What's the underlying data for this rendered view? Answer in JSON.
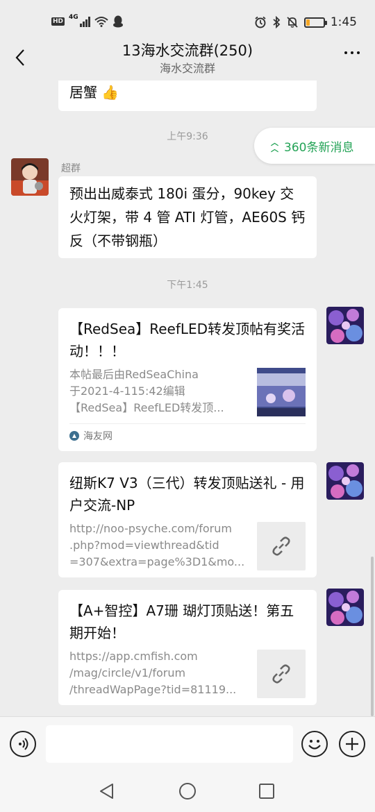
{
  "status_bar": {
    "network_badge": "HD",
    "network_type": "4G",
    "time": "1:45",
    "battery_level": 0.2
  },
  "header": {
    "title": "13海水交流群(250)",
    "subtitle": "海水交流群"
  },
  "new_messages": {
    "label": "360条新消息"
  },
  "messages": {
    "partial_bubble": {
      "text": "居蟹 👍"
    },
    "time_1": "上午9:36",
    "msg_1": {
      "sender": "超群",
      "text": "预出出威泰式 180i 蛋分，90key 交火灯架，带 4 管 ATI 灯管，AE60S 钙反（不带钢瓶）"
    },
    "time_2": "下午1:45",
    "card_1": {
      "title": "【RedSea】ReefLED转发顶帖有奖活动！！！",
      "desc": "本帖最后由RedSeaChina\n于2021-4-115:42编辑\n【RedSea】ReefLED转发顶...",
      "source": "海友网"
    },
    "card_2": {
      "title": "纽斯K7 V3（三代）转发顶贴送礼 - 用户交流-NP",
      "desc": "http://noo-psyche.com/forum\n.php?mod=viewthread&tid\n=307&extra=page%3D1&mo..."
    },
    "card_3": {
      "title": "【A+智控】A7珊 瑚灯顶贴送！第五期开始！",
      "desc": "https://app.cmfish.com\n/mag/circle/v1/forum\n/threadWapPage?tid=81119..."
    }
  },
  "colors": {
    "accent_green": "#23a356",
    "background": "#ededed",
    "bubble": "#ffffff"
  },
  "icons": {
    "back": "chevron-left-icon",
    "more": "more-dots-icon",
    "voice": "voice-icon",
    "emoji": "emoji-icon",
    "plus": "plus-icon",
    "link": "link-icon"
  }
}
